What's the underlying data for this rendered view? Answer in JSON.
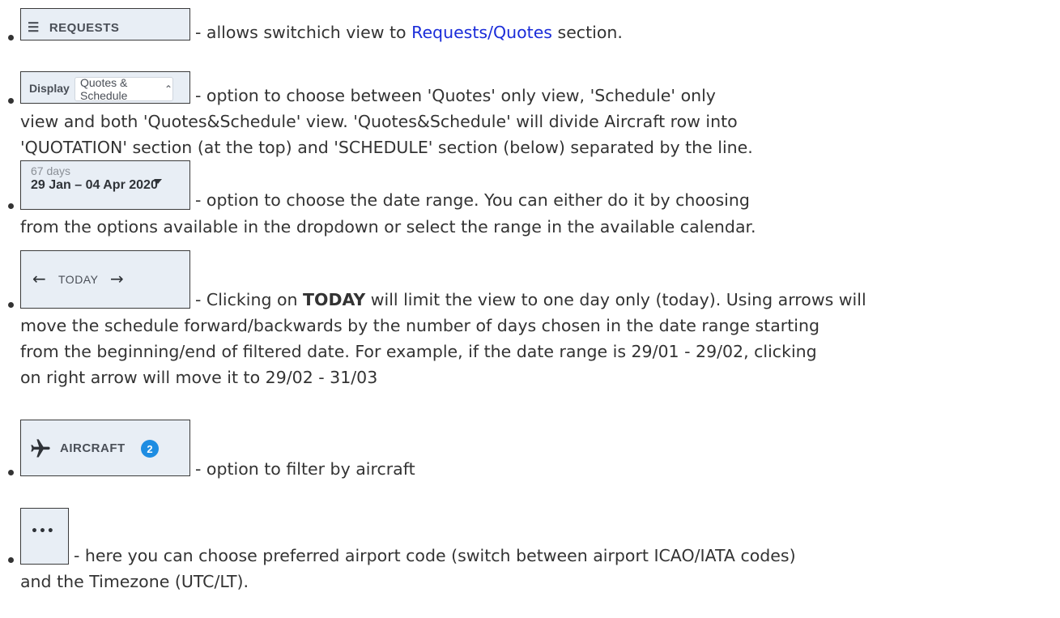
{
  "items": [
    {
      "button": {
        "icon": "list-icon",
        "label": "REQUESTS"
      },
      "lines": [
        {
          "before": "- allows switchich view to ",
          "link": "Requests/Quotes",
          "after": " section."
        }
      ]
    },
    {
      "display": {
        "label": "Display",
        "value": "Quotes & Schedule",
        "chevron": "⌃⌄"
      },
      "lines": [
        "- option to choose between 'Quotes' only view, 'Schedule' only",
        "view and both 'Quotes&Schedule' view. 'Quotes&Schedule' will divide Aircraft row into",
        "'QUOTATION' section (at the top) and 'SCHEDULE' section (below) separated by the line."
      ]
    },
    {
      "date_range": {
        "days": "67 days",
        "range": "29 Jan – 04 Apr 2020"
      },
      "lines": [
        "- option to choose the date range. You can either do it by choosing",
        "from the options available in the dropdown or select the range in the available calendar."
      ]
    },
    {
      "today_nav": {
        "prev": "←",
        "label": "TODAY",
        "next": "→"
      },
      "lines": [
        {
          "before": "- Clicking on ",
          "bold": "TODAY",
          "after": " will limit the view to one day only (today). Using arrows will"
        },
        "move the schedule forward/backwards by the number of days chosen in the date range starting",
        "from the beginning/end of filtered date. For example, if the date range is 29/01 - 29/02, clicking",
        "on right arrow will move it to 29/02 - 31/03"
      ]
    },
    {
      "aircraft": {
        "icon": "airplane-icon",
        "label": "AIRCRAFT",
        "count": "2"
      },
      "lines": [
        "- option to filter by aircraft"
      ]
    },
    {
      "more": {
        "icon": "more-icon",
        "label": "•••"
      },
      "lines": [
        "- here you can choose preferred airport code (switch between airport ICAO/IATA codes)",
        "and the Timezone (UTC/LT)."
      ]
    }
  ]
}
